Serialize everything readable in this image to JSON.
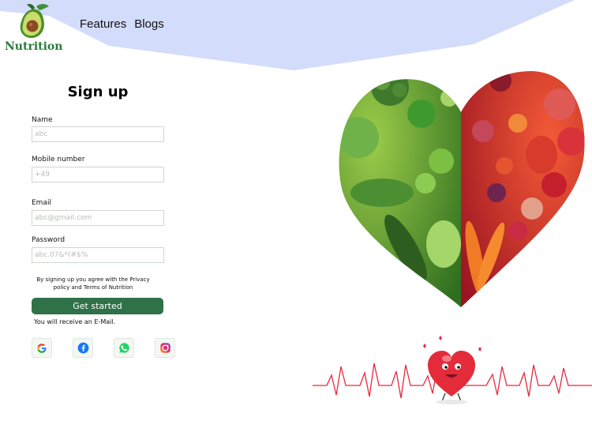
{
  "brand": {
    "name": "Nutrition"
  },
  "nav": [
    {
      "label": "Features"
    },
    {
      "label": "Blogs"
    }
  ],
  "form": {
    "title": "Sign up",
    "fields": [
      {
        "label": "Name",
        "placeholder": "abc"
      },
      {
        "label": "Mobile number",
        "placeholder": "+49"
      },
      {
        "label": "Email",
        "placeholder": "abc@gmail.com"
      },
      {
        "label": "Password",
        "placeholder": "abc.07&*(#$%"
      }
    ],
    "terms": "By signing up you agree with the Privacy policy and Terms of Nutrition",
    "submit_label": "Get started",
    "email_note": "You will receive an E-Mail."
  },
  "social": [
    {
      "icon": "google-icon"
    },
    {
      "icon": "facebook-icon"
    },
    {
      "icon": "whatsapp-icon"
    },
    {
      "icon": "instagram-icon"
    }
  ],
  "colors": {
    "header_band": "#d4dcfb",
    "brand_green": "#2b7b3c",
    "button_green": "#2f7148",
    "pulse_red": "#e8293f"
  }
}
